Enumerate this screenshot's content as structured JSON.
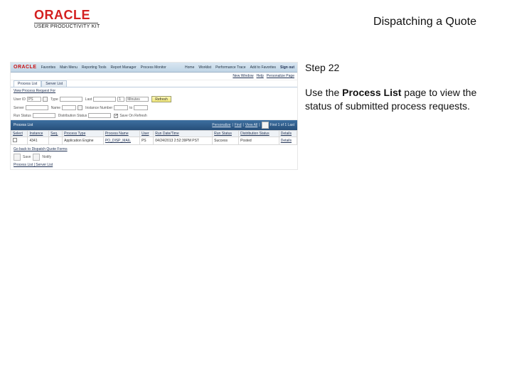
{
  "header": {
    "brand": "ORACLE",
    "product_line": "USER PRODUCTIVITY KIT",
    "topic_title": "Dispatching a Quote"
  },
  "step": {
    "label": "Step 22",
    "instruction_pre": "Use the ",
    "instruction_bold": "Process List",
    "instruction_post": " page to view the status of submitted process requests."
  },
  "thumb": {
    "brand": "ORACLE",
    "nav": {
      "items": [
        "Favorites",
        "Main Menu",
        "Reporting Tools",
        "Report Manager",
        "Process Monitor"
      ],
      "right": [
        "Home",
        "Worklist",
        "Performance Trace",
        "Add to Favorites",
        "Sign out"
      ]
    },
    "topright_links": [
      "New Window",
      "Help",
      "Personalize Page"
    ],
    "tabs": [
      "Process List",
      "Server List"
    ],
    "section_title": "View Process Request For",
    "fields": {
      "user_id_label": "User ID",
      "user_id_value": "PS",
      "type_label": "Type",
      "type_value": "",
      "last_label": "Last",
      "last_value": "1",
      "last_unit": "Minutes",
      "refresh": "Refresh",
      "server_label": "Server",
      "name_label": "Name",
      "instance_label": "Instance Number",
      "to_label": "to",
      "run_status_label": "Run Status",
      "dist_status_label": "Distribution Status",
      "save_on_refresh": "Save On Refresh"
    },
    "grid": {
      "title": "Process List",
      "pager_links": [
        "Personalize",
        "Find",
        "View All"
      ],
      "pager_text": "First 1 of 1 Last",
      "columns": [
        "Select",
        "Instance",
        "Seq.",
        "Process Type",
        "Process Name",
        "User",
        "Run Date/Time",
        "Run Status",
        "Distribution Status",
        "Details"
      ],
      "row": {
        "instance": "4341",
        "seq": "",
        "process_type": "Application Engine",
        "process_name": "PO_DISP_MAIL",
        "user": "PS",
        "run_dt": "04/24/2013 2:52:39PM PST",
        "run_status": "Success",
        "dist_status": "Posted",
        "details": "Details"
      }
    },
    "below": {
      "go_back": "Go back to Dispatch Quote Forms",
      "save": "Save",
      "notify": "Notify",
      "tabs_footer": "Process List | Server List"
    }
  }
}
